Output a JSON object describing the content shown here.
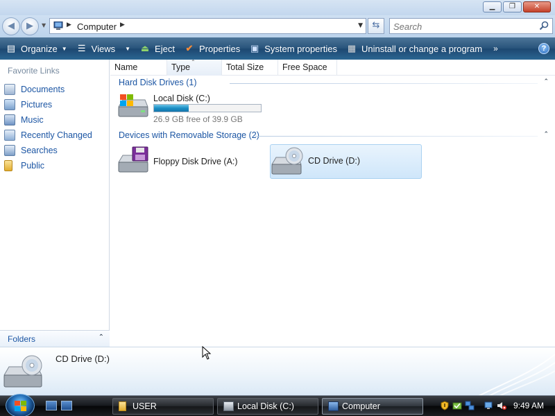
{
  "window": {
    "minimize_glyph": "▁",
    "maximize_glyph": "❐",
    "close_glyph": "✕"
  },
  "address_bar": {
    "back_glyph": "◀",
    "forward_glyph": "▶",
    "location_icon": "computer-icon",
    "breadcrumb": "Computer",
    "refresh_glyph": "⇆",
    "search_placeholder": "Search"
  },
  "command_bar": {
    "items": [
      {
        "label": "Organize",
        "icon": "organize-icon",
        "dropdown": true
      },
      {
        "label": "Views",
        "icon": "views-icon",
        "dropdown": true
      },
      {
        "label": "Eject",
        "icon": "eject-icon"
      },
      {
        "label": "Properties",
        "icon": "properties-checkmark-icon"
      },
      {
        "label": "System properties",
        "icon": "system-properties-icon"
      },
      {
        "label": "Uninstall or change a program",
        "icon": "uninstall-icon"
      }
    ],
    "more_glyph": "»",
    "help_glyph": "?"
  },
  "nav_pane": {
    "title": "Favorite Links",
    "items": [
      {
        "label": "Documents",
        "icon": "documents-icon"
      },
      {
        "label": "Pictures",
        "icon": "pictures-icon"
      },
      {
        "label": "Music",
        "icon": "music-icon"
      },
      {
        "label": "Recently Changed",
        "icon": "recently-changed-icon"
      },
      {
        "label": "Searches",
        "icon": "searches-icon"
      },
      {
        "label": "Public",
        "icon": "public-folder-icon"
      }
    ],
    "folders_label": "Folders"
  },
  "columns": [
    "Name",
    "Type",
    "Total Size",
    "Free Space"
  ],
  "groups": [
    {
      "title": "Hard Disk Drives (1)",
      "drives": [
        {
          "name": "Local Disk (C:)",
          "free_text": "26.9 GB free of 39.9 GB",
          "used_fraction": 0.326
        }
      ]
    },
    {
      "title": "Devices with Removable Storage (2)",
      "drives": [
        {
          "name": "Floppy Disk Drive (A:)"
        },
        {
          "name": "CD Drive (D:)",
          "selected": true
        }
      ]
    }
  ],
  "details_pane": {
    "name": "CD Drive (D:)"
  },
  "taskbar": {
    "buttons": [
      {
        "label": "USER",
        "icon": "folder-icon"
      },
      {
        "label": "Local Disk (C:)",
        "icon": "local-disk-icon"
      },
      {
        "label": "Computer",
        "icon": "computer-icon",
        "active": true
      }
    ],
    "clock": "9:49 AM"
  },
  "colors": {
    "link_blue": "#1b55a3",
    "command_bar": "#27537a",
    "selection": "#cfe6fa",
    "progress_fill": "#1b8fc5"
  }
}
